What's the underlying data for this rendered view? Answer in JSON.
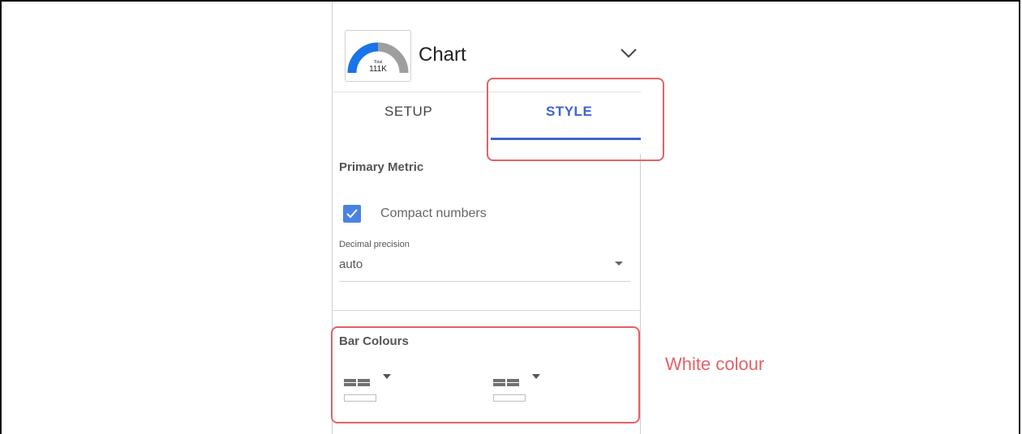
{
  "header": {
    "chart_title": "Chart",
    "thumbnail_label": "111K",
    "thumbnail_sublabel": "Total"
  },
  "tabs": [
    {
      "label": "SETUP",
      "active": false
    },
    {
      "label": "STYLE",
      "active": true
    }
  ],
  "primary_metric": {
    "title": "Primary Metric",
    "compact_numbers_label": "Compact numbers",
    "compact_numbers_checked": true,
    "decimal_precision_label": "Decimal precision",
    "decimal_precision_value": "auto"
  },
  "bar_colours": {
    "title": "Bar Colours",
    "pickers": [
      {
        "color": "#ffffff"
      },
      {
        "color": "#ffffff"
      }
    ]
  },
  "annotation": {
    "text": "White colour",
    "color": "#e46265"
  },
  "colors": {
    "accent": "#3f63d0",
    "checkbox": "#4a82e3",
    "gauge_blue": "#1a73e8",
    "gauge_grey": "#9e9e9e"
  }
}
